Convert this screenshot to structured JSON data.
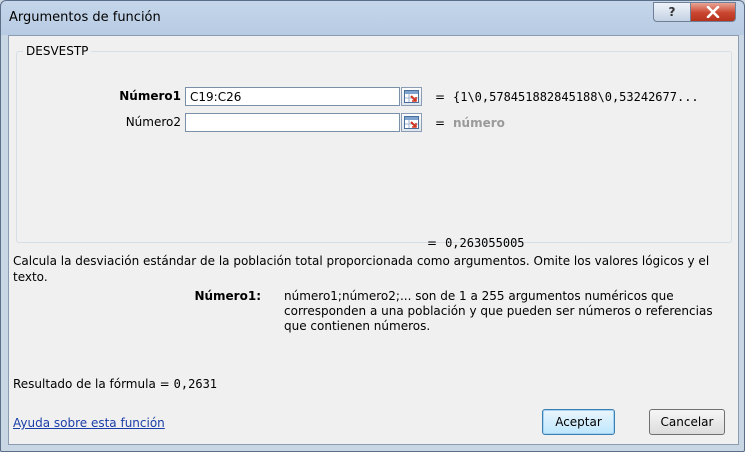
{
  "window": {
    "title": "Argumentos de función",
    "help_glyph": "?",
    "close_glyph": "X"
  },
  "group": {
    "caption": "DESVESTP"
  },
  "args": [
    {
      "label": "Número1",
      "value": "C19:C26",
      "result": "{1\\0,578451882845188\\0,53242677..."
    },
    {
      "label": "Número2",
      "value": "",
      "result": "número"
    }
  ],
  "equals": "=",
  "function_result": "0,263055005",
  "description": "Calcula la desviación estándar de la población total proporcionada como argumentos. Omite los valores lógicos y el texto.",
  "arg_help": {
    "name": "Número1:",
    "text": "número1;número2;... son de 1 a 255 argumentos numéricos que corresponden a una población y que pueden ser números o referencias que contienen números."
  },
  "formula": {
    "label": "Resultado de la fórmula =",
    "value": "0,2631"
  },
  "help_link": "Ayuda sobre esta función",
  "buttons": {
    "ok": "Aceptar",
    "cancel": "Cancelar"
  }
}
